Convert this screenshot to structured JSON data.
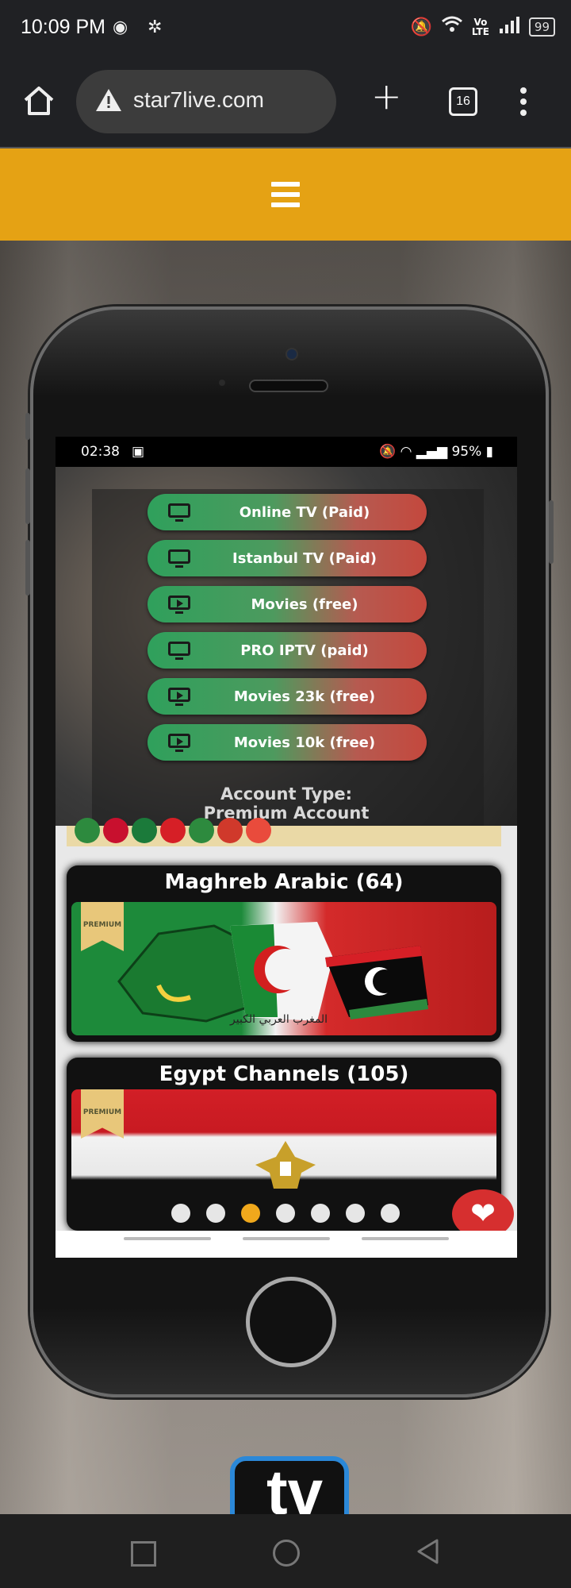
{
  "status_bar": {
    "time": "10:09 PM",
    "carrier_icon": "jazz-icon",
    "battery": "99",
    "volte": "Vo\nLTE"
  },
  "browser": {
    "url": "star7live.com",
    "tab_count": "16"
  },
  "site": {
    "header_color": "#e5a214"
  },
  "mockup": {
    "status_time": "02:38",
    "status_battery": "95%",
    "menu_items": [
      {
        "label": "Online TV (Paid)",
        "icon": "tv-icon"
      },
      {
        "label": "Istanbul TV (Paid)",
        "icon": "tv-icon"
      },
      {
        "label": "Movies (free)",
        "icon": "play-icon"
      },
      {
        "label": "PRO IPTV (paid)",
        "icon": "tv-icon"
      },
      {
        "label": "Movies 23k (free)",
        "icon": "play-icon"
      },
      {
        "label": "Movies 10k (free)",
        "icon": "play-icon"
      }
    ],
    "account_type_label": "Account Type:",
    "account_type_value": "Premium Account",
    "cards": [
      {
        "title": "Maghreb Arabic (64)",
        "badge": "PREMIUM",
        "caption": "المغرب العربي الكبير"
      },
      {
        "title": "Egypt Channels (105)",
        "badge": "PREMIUM"
      }
    ],
    "carousel": {
      "count": 7,
      "active_index": 2
    }
  },
  "logo": {
    "text": "tv"
  },
  "colors": {
    "accent": "#e5a214",
    "button_green": "#2fa05c",
    "button_red": "#c4483d",
    "heart": "#d62f2f",
    "dot_active": "#f0a81c"
  }
}
